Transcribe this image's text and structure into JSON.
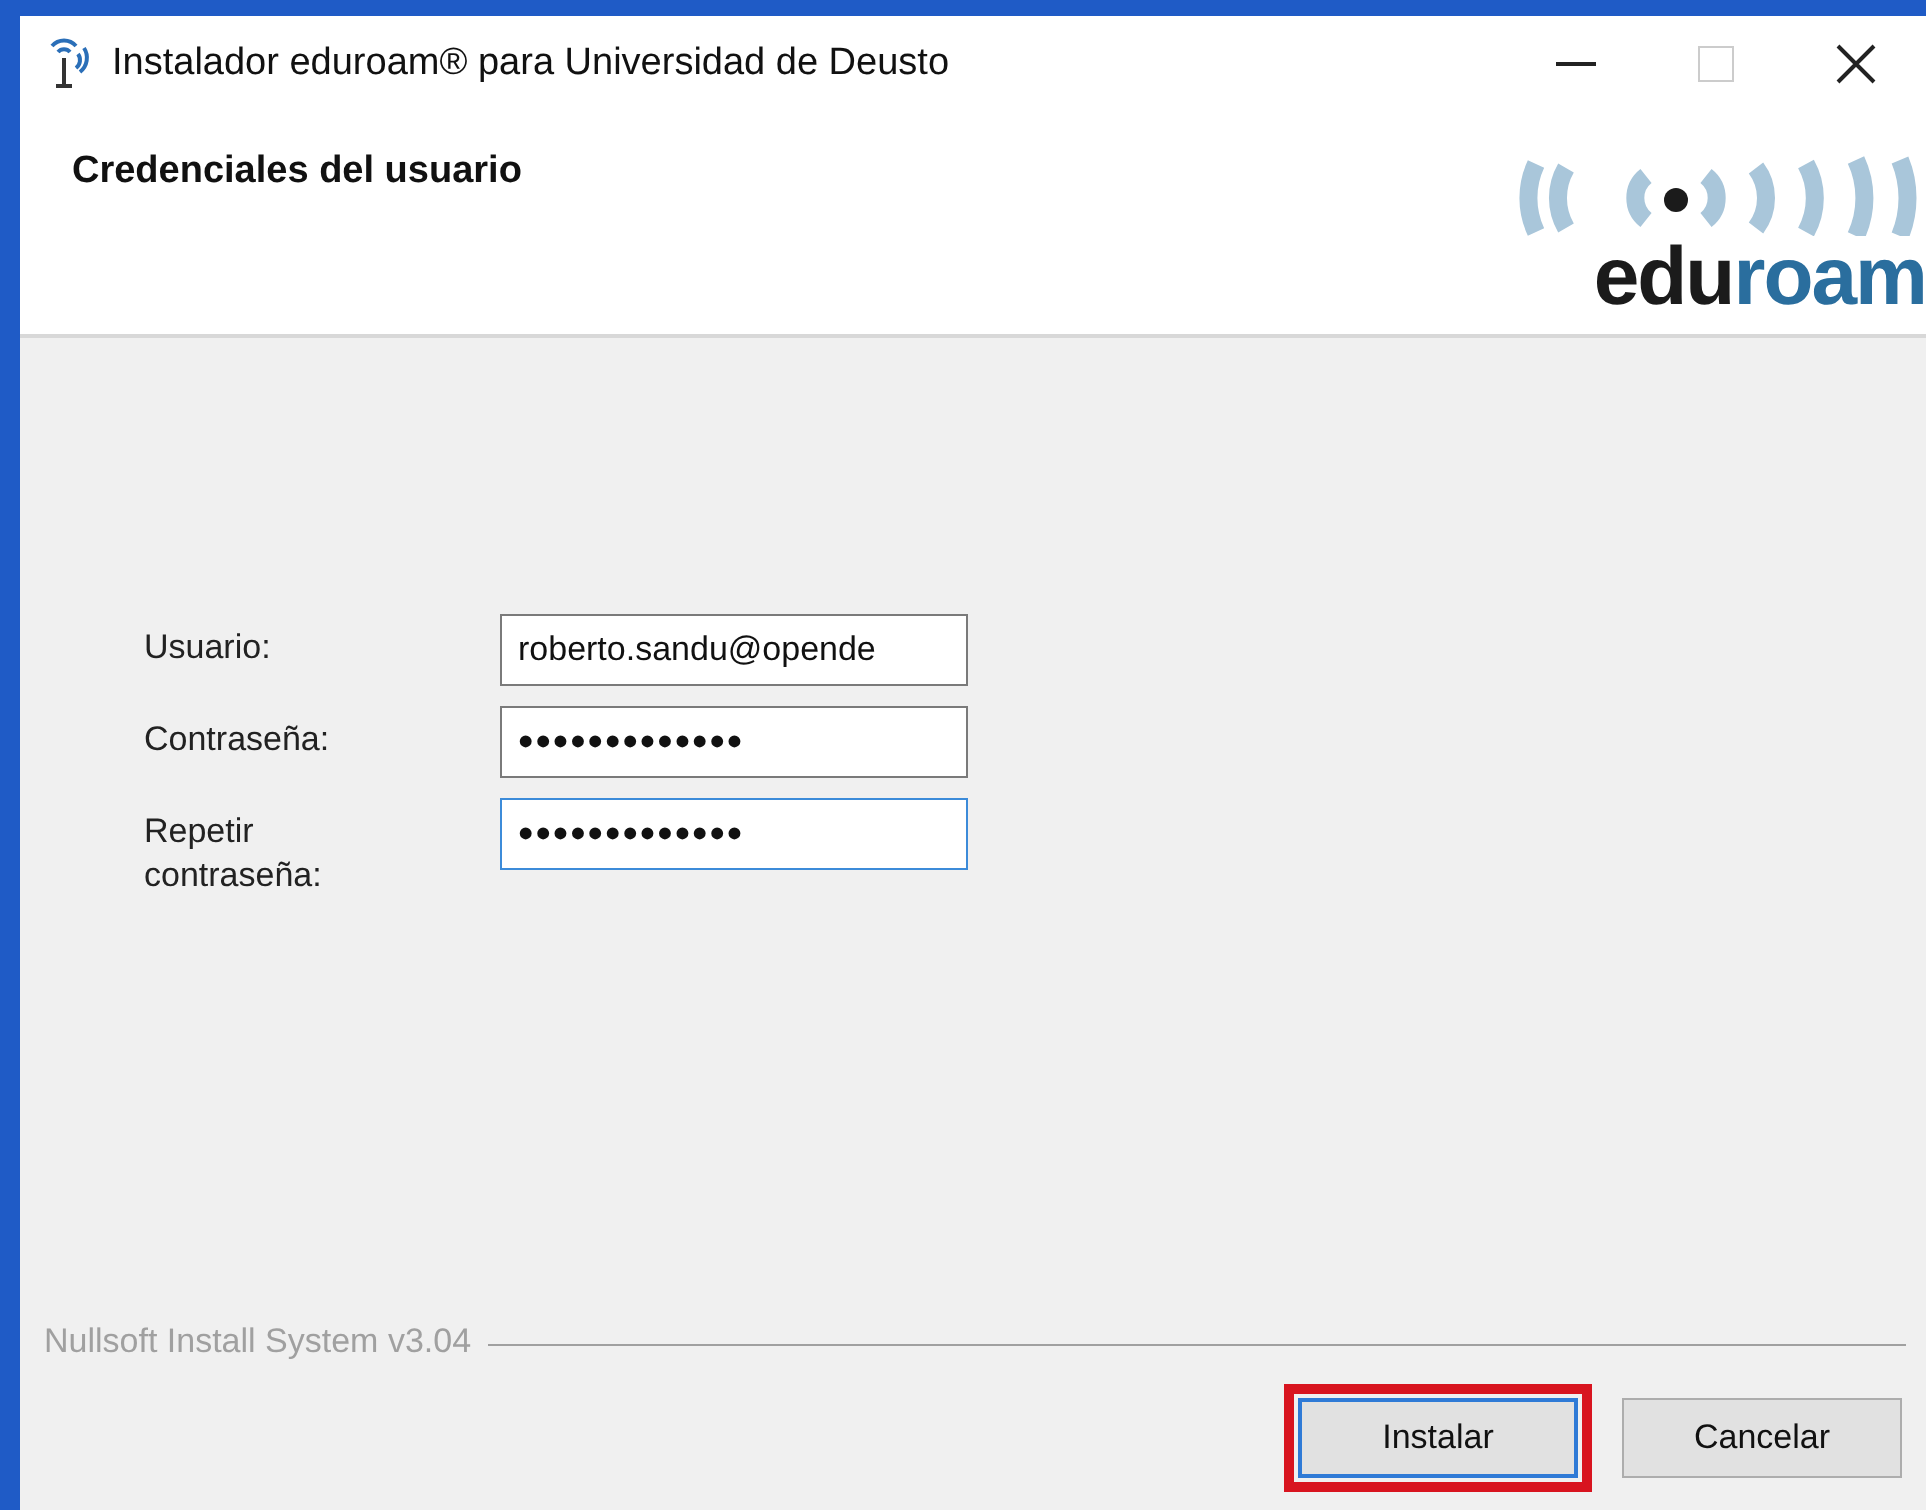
{
  "window": {
    "title": "Instalador eduroam® para Universidad de Deusto"
  },
  "header": {
    "title": "Credenciales del usuario",
    "logo": {
      "prefix": "edu",
      "suffix": "roam"
    }
  },
  "form": {
    "fields": [
      {
        "label": "Usuario:",
        "value": "roberto.sandu@opende",
        "focused": false
      },
      {
        "label": "Contraseña:",
        "value": "•••••••••••••",
        "focused": false
      },
      {
        "label": "Repetir contraseña:",
        "value": "•••••••••••••",
        "focused": true
      }
    ]
  },
  "footer": {
    "branding": "Nullsoft Install System v3.04"
  },
  "buttons": [
    {
      "label": "Instalar",
      "default": true,
      "highlighted": true
    },
    {
      "label": "Cancelar",
      "default": false,
      "highlighted": false
    }
  ]
}
